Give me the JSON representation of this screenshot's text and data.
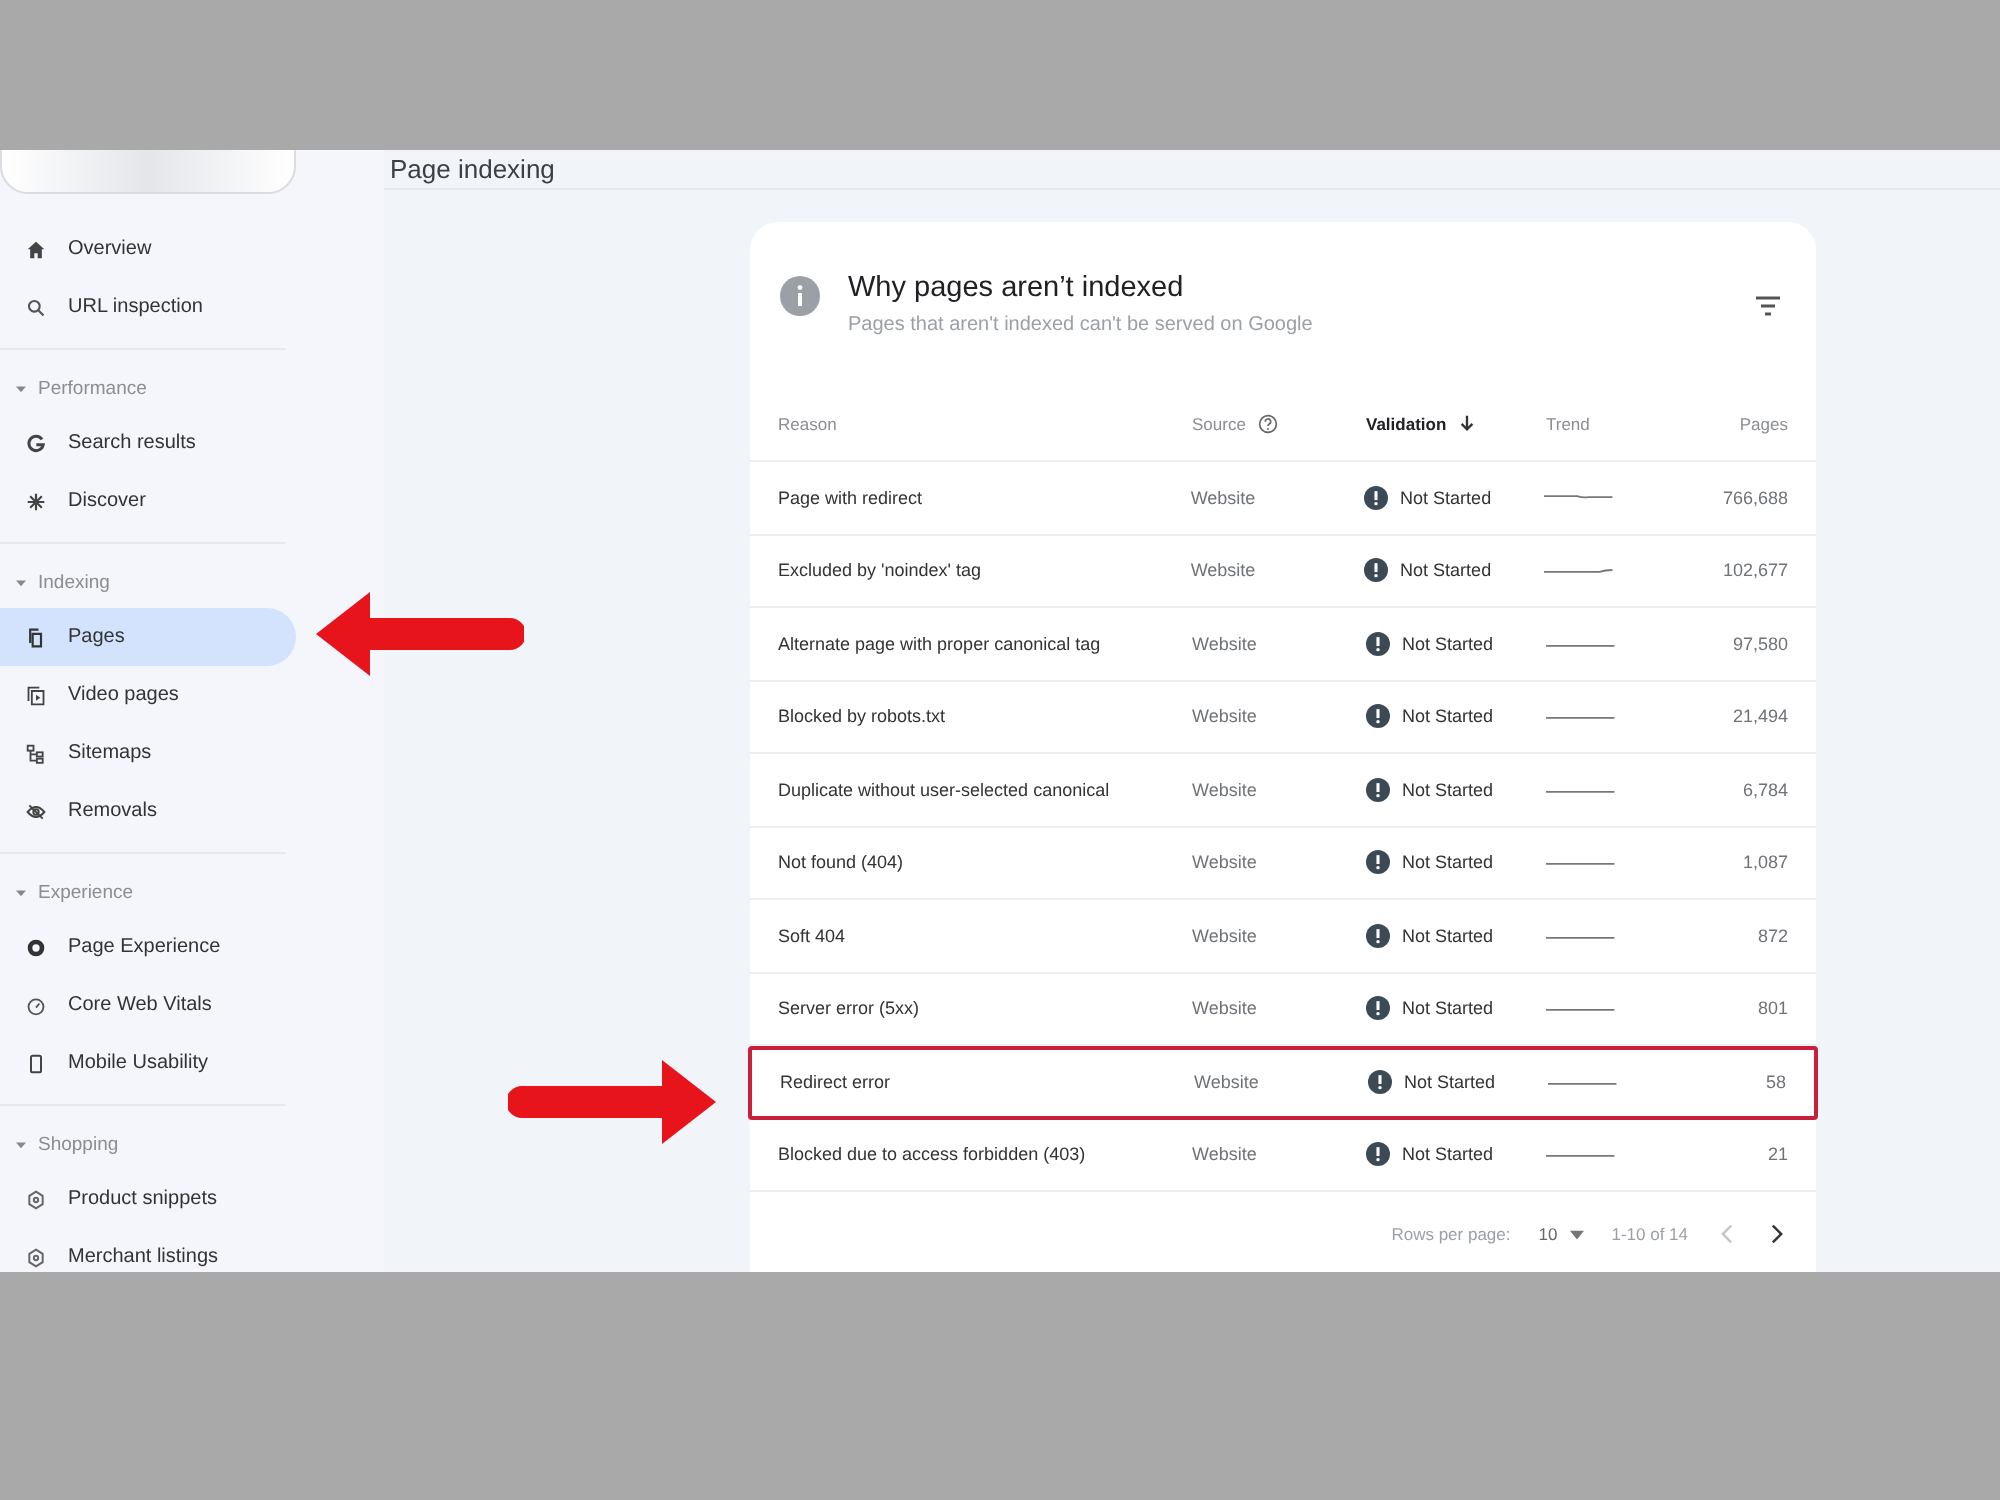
{
  "page_title": "Page indexing",
  "sidebar": {
    "sections": [
      {
        "items": [
          {
            "label": "Overview",
            "selected": false
          },
          {
            "label": "URL inspection",
            "selected": false
          }
        ]
      },
      {
        "header": "Performance",
        "expanded": true,
        "items": [
          {
            "label": "Search results",
            "selected": false
          },
          {
            "label": "Discover",
            "selected": false
          }
        ]
      },
      {
        "header": "Indexing",
        "expanded": true,
        "items": [
          {
            "label": "Pages",
            "selected": true
          },
          {
            "label": "Video pages",
            "selected": false
          },
          {
            "label": "Sitemaps",
            "selected": false
          },
          {
            "label": "Removals",
            "selected": false
          }
        ]
      },
      {
        "header": "Experience",
        "expanded": true,
        "items": [
          {
            "label": "Page Experience",
            "selected": false
          },
          {
            "label": "Core Web Vitals",
            "selected": false
          },
          {
            "label": "Mobile Usability",
            "selected": false
          }
        ]
      },
      {
        "header": "Shopping",
        "expanded": true,
        "items": [
          {
            "label": "Product snippets",
            "selected": false
          },
          {
            "label": "Merchant listings",
            "selected": false
          }
        ]
      }
    ]
  },
  "card": {
    "title": "Why pages aren’t indexed",
    "subtitle": "Pages that aren't indexed can't be served on Google",
    "columns": [
      {
        "label": "Reason",
        "help": false,
        "sorted": false
      },
      {
        "label": "Source",
        "help": true,
        "sorted": false
      },
      {
        "label": "Validation",
        "help": false,
        "sorted": true
      },
      {
        "label": "Trend",
        "help": false,
        "sorted": false
      },
      {
        "label": "Pages",
        "help": false,
        "sorted": false
      }
    ],
    "rows": [
      {
        "reason": "Page with redirect",
        "source": "Website",
        "validation": "Not Started",
        "pages": "766,688",
        "highlighted": false
      },
      {
        "reason": "Excluded by 'noindex' tag",
        "source": "Website",
        "validation": "Not Started",
        "pages": "102,677",
        "highlighted": false
      },
      {
        "reason": "Alternate page with proper canonical tag",
        "source": "Website",
        "validation": "Not Started",
        "pages": "97,580",
        "highlighted": false
      },
      {
        "reason": "Blocked by robots.txt",
        "source": "Website",
        "validation": "Not Started",
        "pages": "21,494",
        "highlighted": false
      },
      {
        "reason": "Duplicate without user-selected canonical",
        "source": "Website",
        "validation": "Not Started",
        "pages": "6,784",
        "highlighted": false
      },
      {
        "reason": "Not found (404)",
        "source": "Website",
        "validation": "Not Started",
        "pages": "1,087",
        "highlighted": false
      },
      {
        "reason": "Soft 404",
        "source": "Website",
        "validation": "Not Started",
        "pages": "872",
        "highlighted": false
      },
      {
        "reason": "Server error (5xx)",
        "source": "Website",
        "validation": "Not Started",
        "pages": "801",
        "highlighted": false
      },
      {
        "reason": "Redirect error",
        "source": "Website",
        "validation": "Not Started",
        "pages": "58",
        "highlighted": true
      },
      {
        "reason": "Blocked due to access forbidden (403)",
        "source": "Website",
        "validation": "Not Started",
        "pages": "21",
        "highlighted": false
      }
    ],
    "pagination": {
      "rows_per_page_label": "Rows per page:",
      "rows_per_page": "10",
      "range": "1-10 of 14",
      "prev_disabled": true,
      "next_disabled": false
    }
  },
  "annotations": [
    {
      "kind": "left-arrow"
    },
    {
      "kind": "right-arrow"
    }
  ]
}
